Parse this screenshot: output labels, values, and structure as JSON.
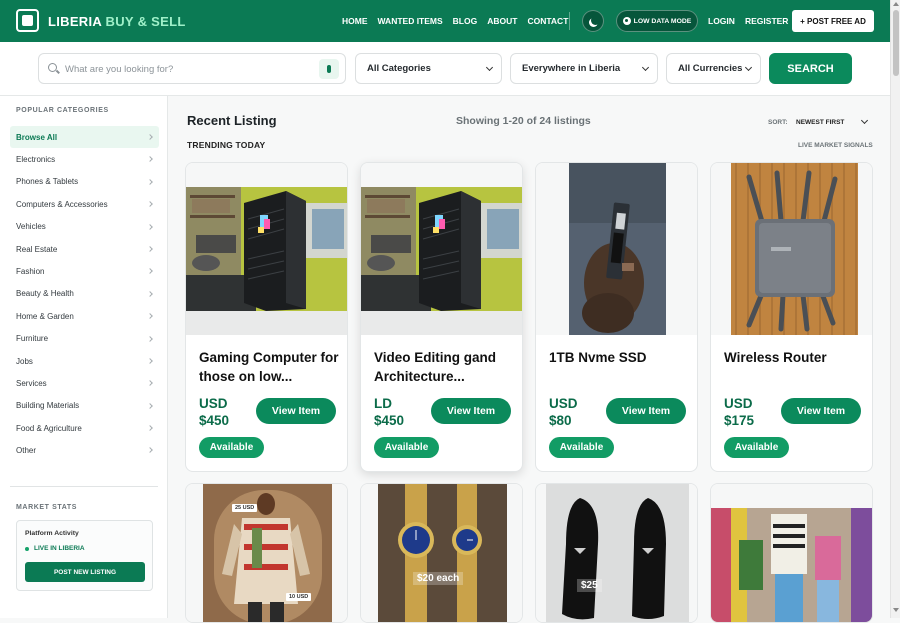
{
  "header": {
    "brand_main": "LIBERIA",
    "brand_accent": "BUY & SELL",
    "nav": [
      "HOME",
      "WANTED ITEMS",
      "BLOG",
      "ABOUT",
      "CONTACT"
    ],
    "low_data_label": "LOW DATA MODE",
    "login": "LOGIN",
    "register": "REGISTER",
    "post_ad": "+ POST FREE AD"
  },
  "search": {
    "placeholder": "What are you looking for?",
    "category": "All Categories",
    "location": "Everywhere in Liberia",
    "currency": "All Currencies",
    "button": "SEARCH"
  },
  "sidebar": {
    "title": "POPULAR CATEGORIES",
    "categories": [
      "Browse All",
      "Electronics",
      "Phones & Tablets",
      "Computers & Accessories",
      "Vehicles",
      "Real Estate",
      "Fashion",
      "Beauty & Health",
      "Home & Garden",
      "Furniture",
      "Jobs",
      "Services",
      "Building Materials",
      "Food & Agriculture",
      "Other"
    ],
    "stats_title": "MARKET STATS",
    "platform_activity": "Platform Activity",
    "live_status": "LIVE IN LIBERIA",
    "post_listing": "POST NEW LISTING"
  },
  "main": {
    "title": "Recent Listing",
    "showing": "Showing 1-20 of 24 listings",
    "sort_label": "SORT:",
    "sort_value": "NEWEST FIRST",
    "trending": "TRENDING TODAY",
    "live_signals": "LIVE MARKET SIGNALS"
  },
  "listings": [
    {
      "title": "Gaming Computer for those on low...",
      "currency": "USD",
      "price": "$450",
      "button": "View Item",
      "status": "Available"
    },
    {
      "title": "Video Editing gand Architecture...",
      "currency": "LD",
      "price": "$450",
      "button": "View Item",
      "status": "Available"
    },
    {
      "title": "1TB Nvme SSD",
      "currency": "USD",
      "price": "$80",
      "button": "View Item",
      "status": "Available"
    },
    {
      "title": "Wireless Router",
      "currency": "USD",
      "price": "$175",
      "button": "View Item",
      "status": "Available"
    }
  ],
  "photo_labels": {
    "shirt_top": "25 USD",
    "shirt_bottom": "10 USD",
    "watches": "$20 each",
    "shoes": "$25"
  },
  "colors": {
    "brand_green": "#0b7a54",
    "button_green": "#0b8a5c",
    "badge_green": "#129c65"
  }
}
